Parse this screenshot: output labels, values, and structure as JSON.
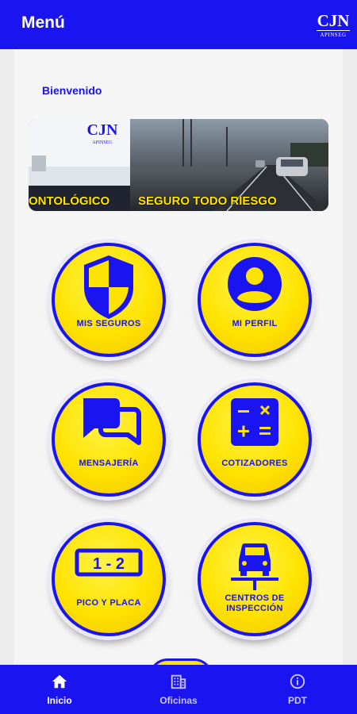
{
  "header": {
    "title": "Menú",
    "logo_mark": "CJN",
    "logo_sub": "APINSEG",
    "logo_icon": "cjn-logo"
  },
  "welcome": "Bienvenido",
  "banner": {
    "logo_mark": "CJN",
    "logo_sub": "APINSEG",
    "left_caption": "ONTOLÓGICO",
    "right_caption": "SEGURO TODO RIESGO"
  },
  "menu": [
    {
      "label": "MIS SEGUROS",
      "icon": "shield-icon"
    },
    {
      "label": "MI PERFIL",
      "icon": "user-profile-icon"
    },
    {
      "label": "MENSAJERÍA",
      "icon": "chat-bubbles-icon"
    },
    {
      "label": "COTIZADORES",
      "icon": "calculator-icon"
    },
    {
      "label": "PICO Y PLACA",
      "icon": "license-plate-icon"
    },
    {
      "label_line1": "CENTROS DE",
      "label_line2": "INSPECCIÓN",
      "icon": "car-lift-icon"
    }
  ],
  "colors": {
    "primary": "#1a14f0",
    "accent": "#ffe300",
    "background": "#f5f5f5"
  },
  "nav": {
    "tabs": [
      {
        "label": "Inicio",
        "icon": "home-icon",
        "active": true
      },
      {
        "label": "Oficinas",
        "icon": "building-icon",
        "active": false
      },
      {
        "label": "PDT",
        "icon": "info-icon",
        "active": false
      }
    ]
  }
}
